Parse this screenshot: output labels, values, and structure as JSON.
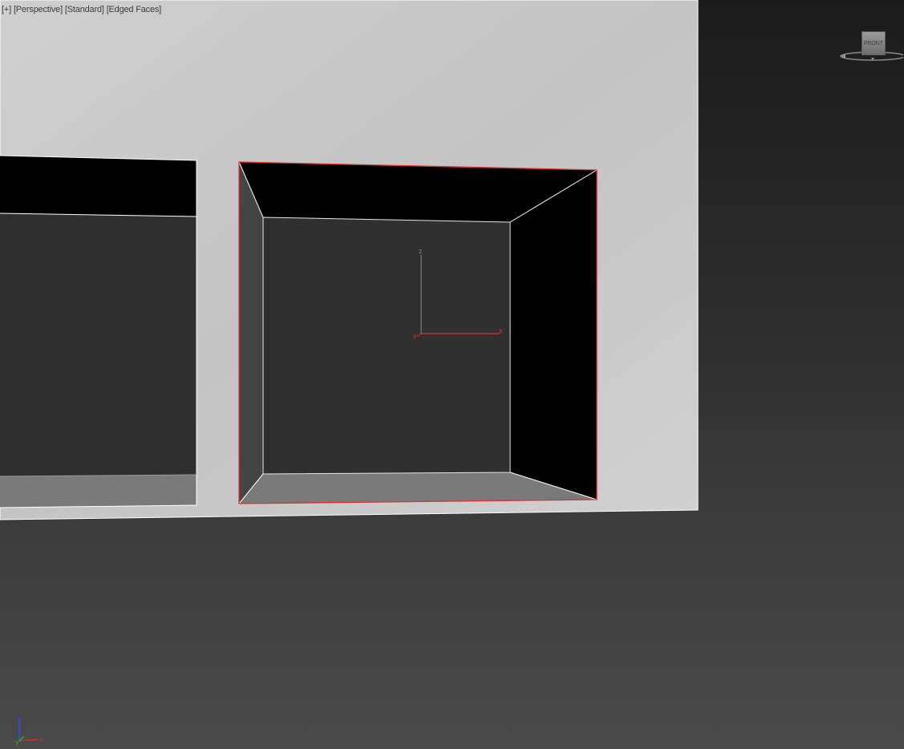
{
  "viewport": {
    "labels": [
      "[+]",
      "[Perspective]",
      "[Standard]",
      "[Edged Faces]"
    ]
  },
  "viewcube": {
    "face_label": "FRONT",
    "icon": "viewcube-icon"
  },
  "gizmo": {
    "z_label": "z",
    "y_label": "y",
    "x_label": "x"
  },
  "world_axis": {
    "z_label": "z",
    "y_label": "y",
    "x_label": "x"
  },
  "colors": {
    "wall": "#c9c9c9",
    "selection": "#e03030",
    "edge": "#ffffff",
    "back_face": "#303030",
    "floor_face": "#7a7a7a",
    "left_face": "#444444",
    "dark_face": "#000000"
  }
}
